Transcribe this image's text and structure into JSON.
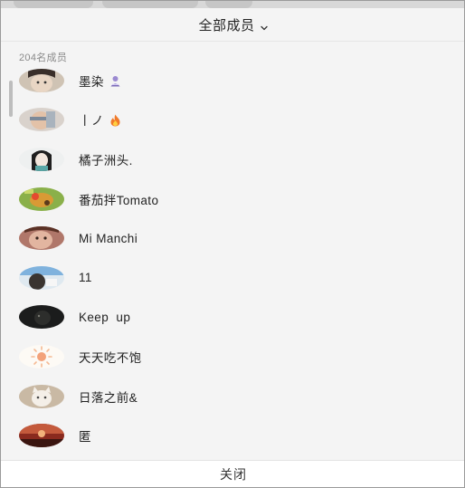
{
  "header": {
    "title": "全部成员"
  },
  "member_count": "204名成员",
  "members": [
    {
      "name": "墨染",
      "emoji": "person-icon"
    },
    {
      "name": "丨ノ",
      "emoji": "fire-icon"
    },
    {
      "name": "橘子洲头."
    },
    {
      "name": "番茄拌Tomato"
    },
    {
      "name": "Mi Manchi"
    },
    {
      "name": "11"
    },
    {
      "name": "Keep  up"
    },
    {
      "name": "天天吃不饱"
    },
    {
      "name": "日落之前&"
    },
    {
      "name": "匿"
    }
  ],
  "footer": {
    "close_label": "关闭"
  },
  "colors": {
    "background": "#f4f4f4",
    "text": "#222222",
    "secondary_text": "#8a8a8a",
    "footer_bg": "#ffffff"
  }
}
